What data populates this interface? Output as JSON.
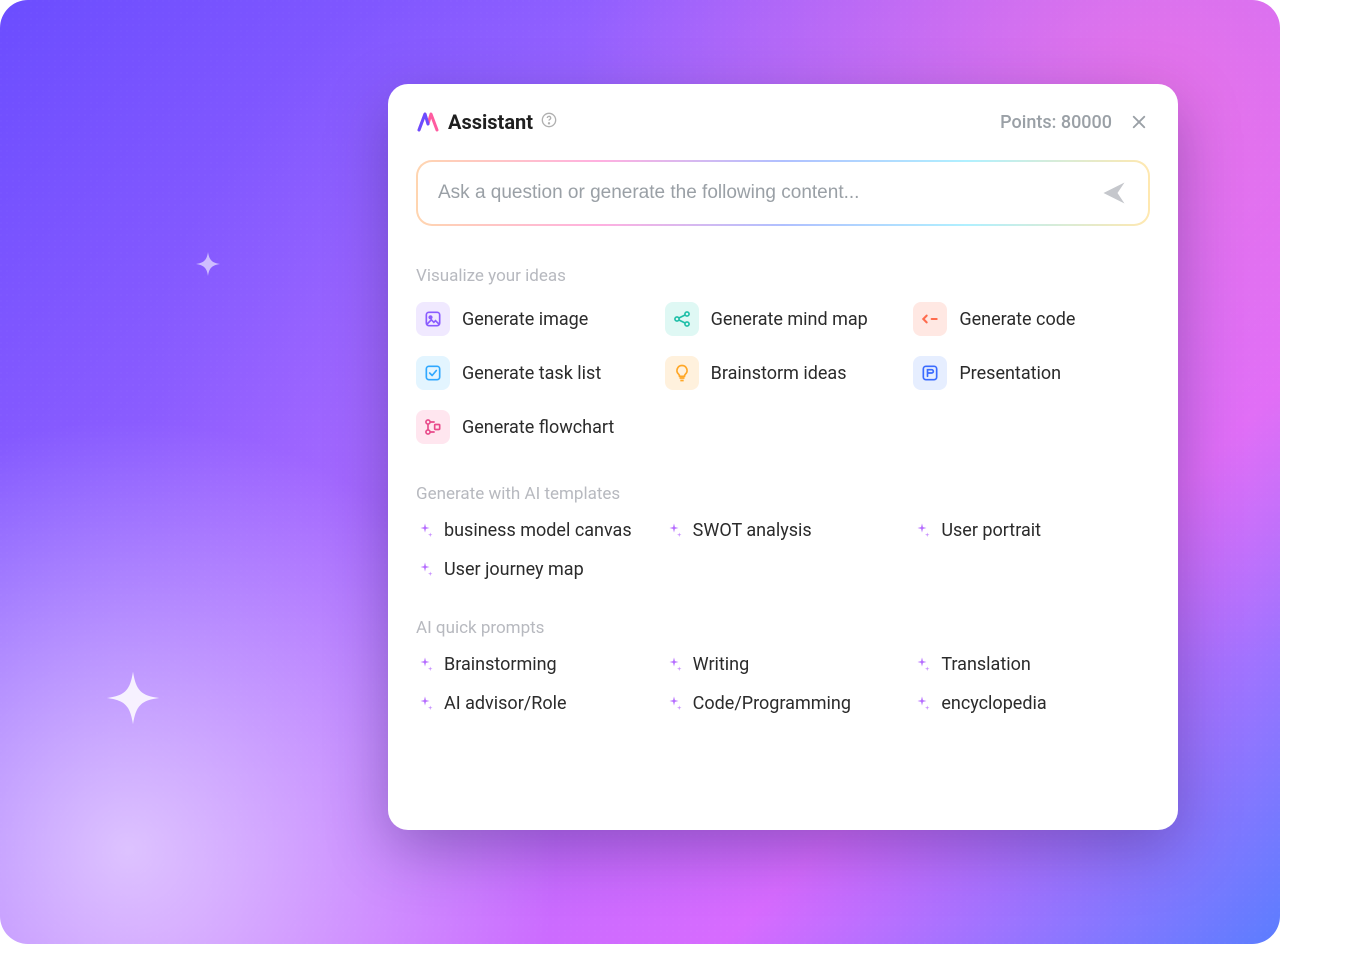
{
  "header": {
    "title": "Assistant",
    "points_label": "Points: 80000"
  },
  "input": {
    "placeholder": "Ask a question or generate the following content..."
  },
  "sections": {
    "visualize_label": "Visualize your ideas",
    "templates_label": "Generate with AI templates",
    "prompts_label": "AI quick prompts"
  },
  "visualize": [
    {
      "label": "Generate image",
      "icon": "image-icon",
      "bg": "bg-purple"
    },
    {
      "label": "Generate mind map",
      "icon": "mindmap-icon",
      "bg": "bg-teal"
    },
    {
      "label": "Generate code",
      "icon": "code-icon",
      "bg": "bg-red"
    },
    {
      "label": "Generate task list",
      "icon": "checklist-icon",
      "bg": "bg-cyan"
    },
    {
      "label": "Brainstorm ideas",
      "icon": "lightbulb-icon",
      "bg": "bg-orange"
    },
    {
      "label": "Presentation",
      "icon": "presentation-icon",
      "bg": "bg-blue"
    },
    {
      "label": "Generate flowchart",
      "icon": "flowchart-icon",
      "bg": "bg-pink"
    }
  ],
  "templates": [
    {
      "label": "business model canvas"
    },
    {
      "label": "SWOT analysis"
    },
    {
      "label": "User portrait"
    },
    {
      "label": "User journey map"
    }
  ],
  "prompts": [
    {
      "label": "Brainstorming"
    },
    {
      "label": "Writing"
    },
    {
      "label": "Translation"
    },
    {
      "label": "AI advisor/Role"
    },
    {
      "label": "Code/Programming"
    },
    {
      "label": "encyclopedia"
    }
  ]
}
